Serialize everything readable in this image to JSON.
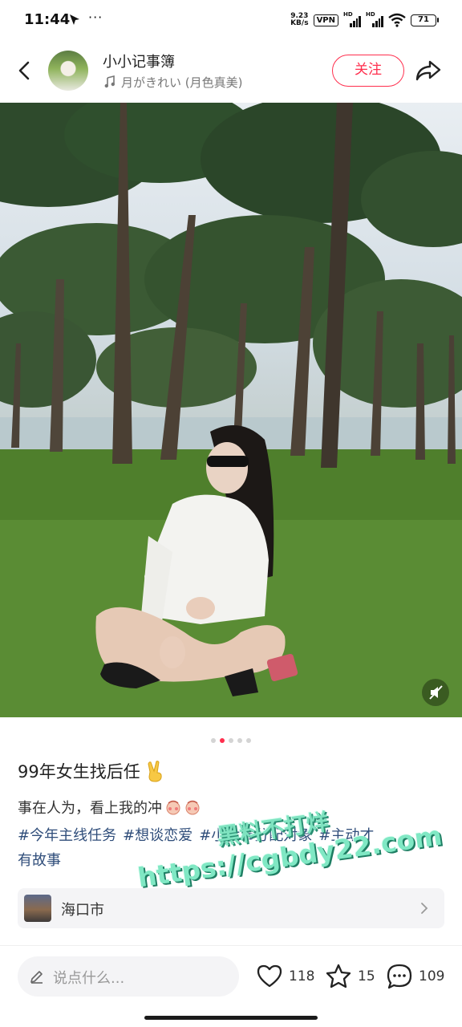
{
  "status_bar": {
    "time": "11:44",
    "net_speed_value": "9.23",
    "net_speed_unit": "KB/s",
    "vpn": "VPN",
    "hd_label": "HD",
    "battery": "71"
  },
  "header": {
    "author_name": "小小记事簿",
    "music_label": "月がきれい (月色真美)",
    "follow_label": "关注"
  },
  "carousel": {
    "total": 5,
    "active_index": 1
  },
  "post": {
    "title": "99年女生找后任",
    "description": "事在人为，看上我的冲",
    "tags_line1": [
      "#今年主线任务",
      "#想谈恋爱",
      "#小六市分配对象",
      "#主动才"
    ],
    "tags_line2": "有故事"
  },
  "watermark": {
    "top_text": "黑料不打烊",
    "url_text": "https://cgbdy22.com"
  },
  "location": {
    "label": "海口市"
  },
  "bottom_bar": {
    "comment_placeholder": "说点什么...",
    "likes": "118",
    "favorites": "15",
    "comments": "109"
  },
  "colors": {
    "accent": "#ff2e4d",
    "tag_text": "#2f4d7a",
    "watermark": "#80e8c4"
  },
  "icons": [
    "back-icon",
    "music-icon",
    "share-icon",
    "mute-icon",
    "peace-icon",
    "location-chevron-icon",
    "pencil-icon",
    "heart-icon",
    "star-icon",
    "comment-icon",
    "wifi-icon"
  ]
}
